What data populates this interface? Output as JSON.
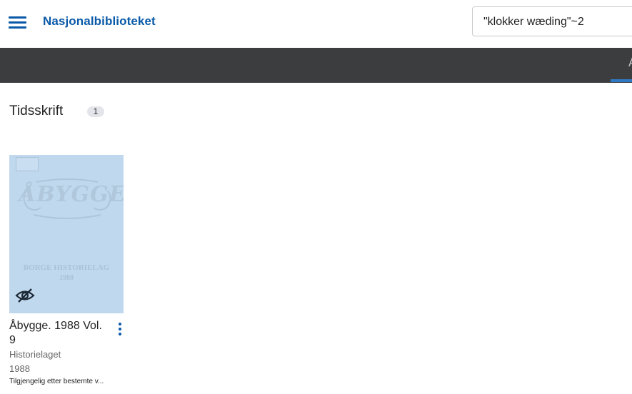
{
  "header": {
    "brand": "Nasjonalbiblioteket",
    "search_value": "\"klokker wæding\"~2"
  },
  "tabbar": {
    "partial_tab": "A"
  },
  "section": {
    "title": "Tidsskrift",
    "count": "1"
  },
  "results": [
    {
      "title": "Åbygge. 1988 Vol. 9",
      "publisher": "Historielaget",
      "year": "1988",
      "access": "Tilgjengelig etter bestemte v...",
      "cover": {
        "logo_text": "ÅBYGGE",
        "subtitle": "BORGE HISTORIELAG",
        "year": "1988",
        "color": "#bfd8ee"
      },
      "icon": "eye-off-icon"
    }
  ],
  "colors": {
    "brand": "#0a5aa8",
    "navbar": "#3c3d3f",
    "active_tab": "#2f78c4"
  }
}
